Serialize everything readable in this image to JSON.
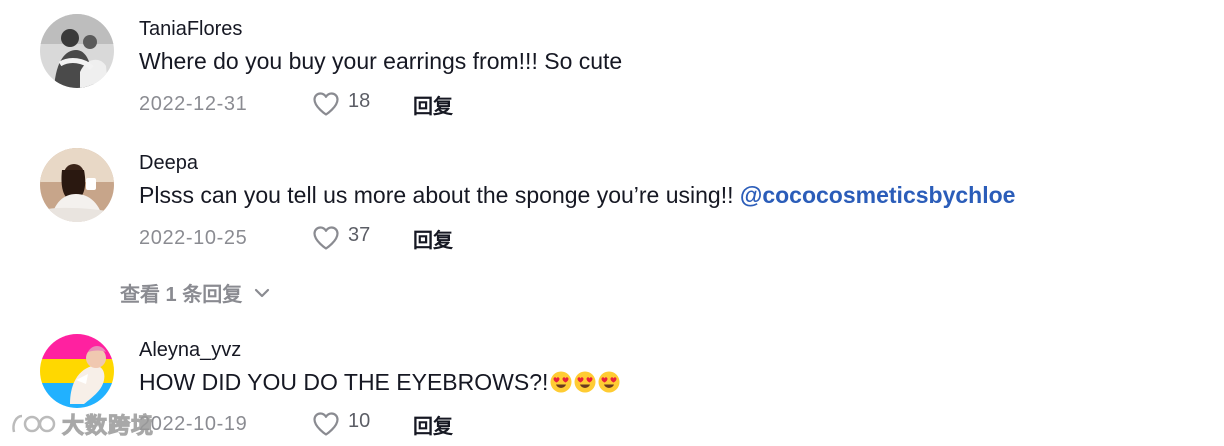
{
  "comments": [
    {
      "username": "TaniaFlores",
      "text": "Where do you buy your earrings from!!! So cute",
      "date": "2022-12-31",
      "likes": "18",
      "reply_label": "回复"
    },
    {
      "username": "Deepa",
      "text": "Plsss can you tell us more about the sponge you’re using!! ",
      "mention": "@cococosmeticsbychloe",
      "date": "2022-10-25",
      "likes": "37",
      "reply_label": "回复",
      "view_replies_label": "查看 1 条回复"
    },
    {
      "username": "Aleyna_yvz",
      "text": "HOW DID YOU DO THE EYEBROWS?!",
      "emojis": [
        "heart-eyes-emoji",
        "heart-eyes-emoji",
        "heart-eyes-emoji"
      ],
      "date": "2022-10-19",
      "likes": "10",
      "reply_label": "回复"
    }
  ],
  "watermark": {
    "text": "大数跨境"
  },
  "colors": {
    "text": "#161823",
    "muted": "#8a8b91",
    "mention": "#2b5db9",
    "pride_pink": "#ff21a0",
    "pride_yellow": "#ffd800",
    "pride_blue": "#21b1ff"
  }
}
